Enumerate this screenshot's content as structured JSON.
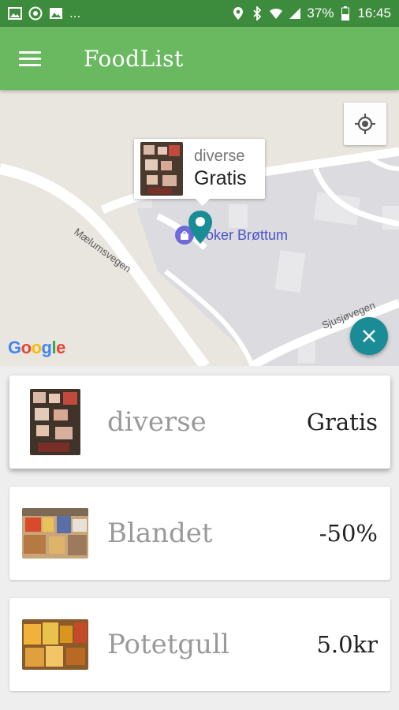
{
  "status_bar": {
    "left_dots": "...",
    "battery": "37%",
    "time": "16:45"
  },
  "app_bar": {
    "title": "FoodList",
    "menu_icon": "hamburger-menu-icon"
  },
  "map": {
    "road_labels": [
      "Mælumsvegen",
      "Sjusjøvegen"
    ],
    "poi_label": "Joker Brøttum",
    "info_window": {
      "title": "diverse",
      "price": "Gratis"
    },
    "google_logo": "Google",
    "locate_icon": "my-location-icon",
    "close_icon": "close-icon",
    "accent_color": "#1a8c96"
  },
  "listings": [
    {
      "name": "diverse",
      "price": "Gratis",
      "selected": true
    },
    {
      "name": "Blandet",
      "price": "-50%",
      "selected": false
    },
    {
      "name": "Potetgull",
      "price": "5.0kr",
      "selected": false
    }
  ],
  "colors": {
    "app_bar": "#6ab961",
    "status_bar": "#3d8b3d"
  }
}
